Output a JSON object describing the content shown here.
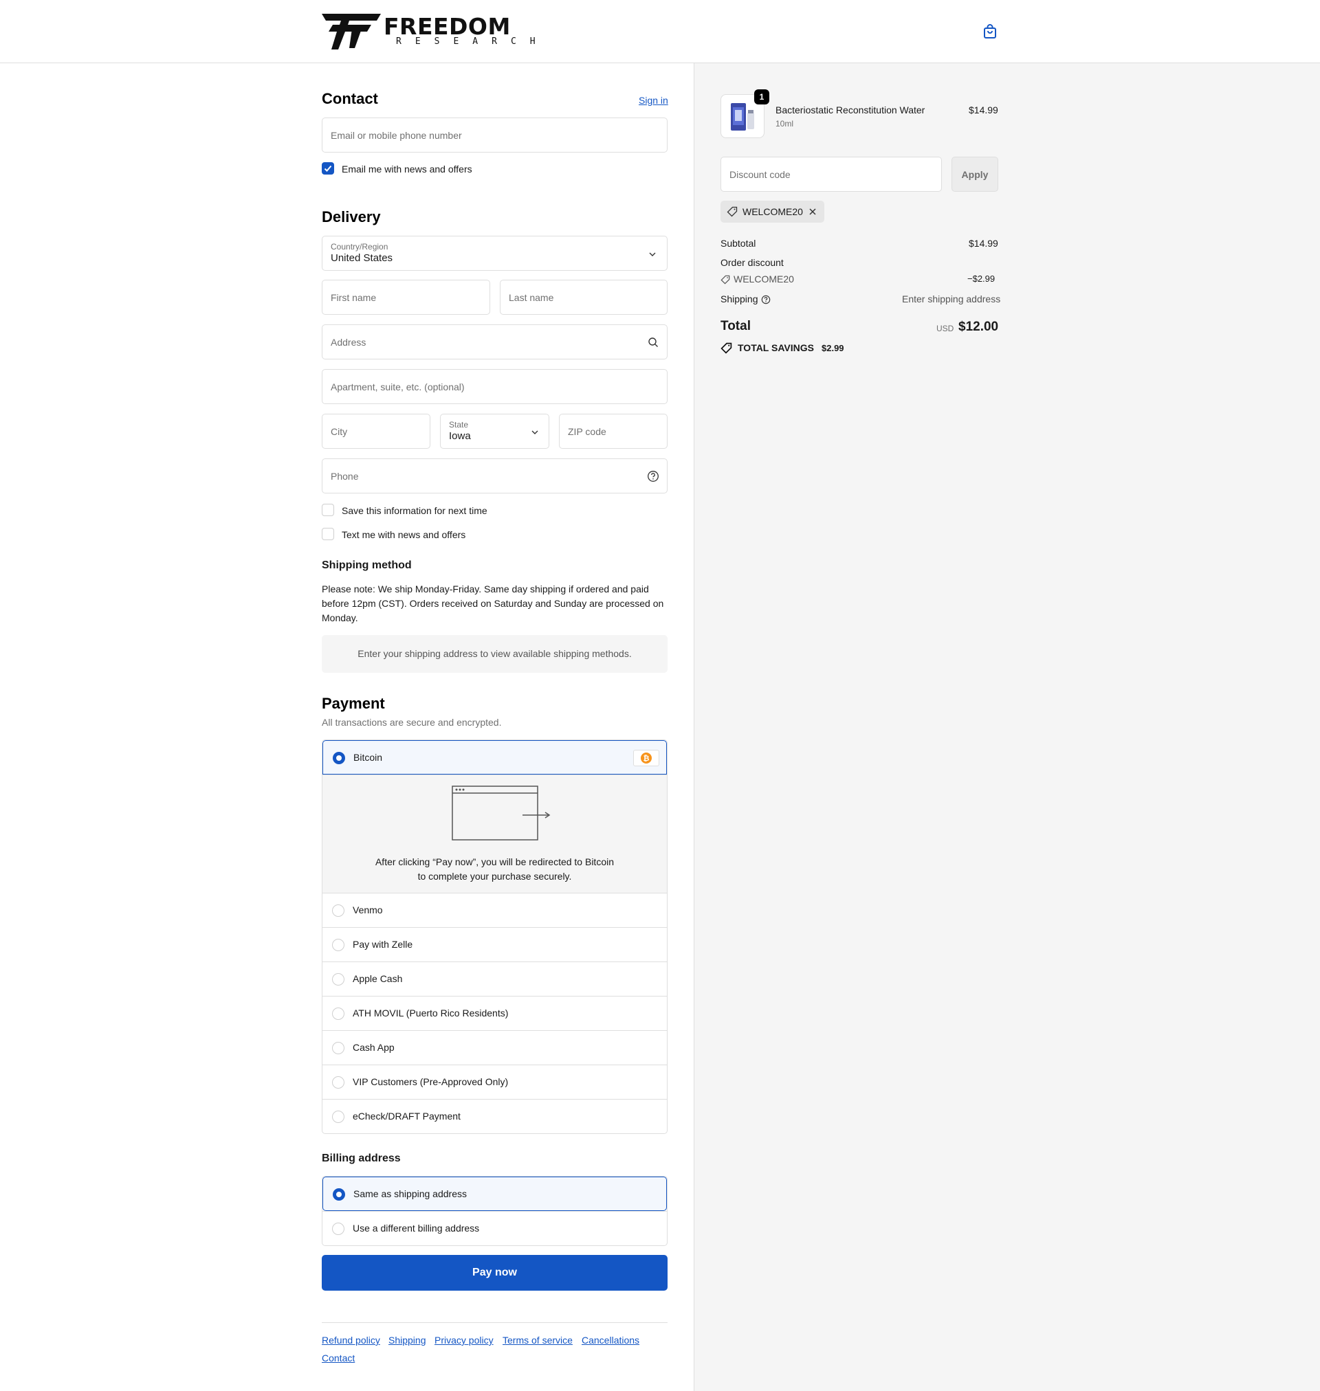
{
  "brand": {
    "name": "FREEDOM",
    "tagline": "RESEARCH"
  },
  "contact": {
    "title": "Contact",
    "sign_in": "Sign in",
    "email_placeholder": "Email or mobile phone number",
    "news_label": "Email me with news and offers",
    "news_checked": true
  },
  "delivery": {
    "title": "Delivery",
    "country_label": "Country/Region",
    "country_value": "United States",
    "first_name_placeholder": "First name",
    "last_name_placeholder": "Last name",
    "address_placeholder": "Address",
    "apartment_placeholder": "Apartment, suite, etc. (optional)",
    "city_placeholder": "City",
    "state_label": "State",
    "state_value": "Iowa",
    "zip_placeholder": "ZIP code",
    "phone_placeholder": "Phone",
    "save_info_label": "Save this information for next time",
    "text_me_label": "Text me with news and offers"
  },
  "shipping_method": {
    "title": "Shipping method",
    "note": "Please note: We ship Monday-Friday. Same day shipping if ordered and paid before 12pm (CST). Orders received on Saturday and Sunday are processed on Monday.",
    "placeholder_box": "Enter your shipping address to view available shipping methods."
  },
  "payment": {
    "title": "Payment",
    "subtitle": "All transactions are secure and encrypted.",
    "selected": "Bitcoin",
    "redirect_text_1": "After clicking “Pay now”, you will be redirected to Bitcoin",
    "redirect_text_2": "to complete your purchase securely.",
    "options": [
      "Venmo",
      "Pay with Zelle",
      "Apple Cash",
      "ATH MOVIL (Puerto Rico Residents)",
      "Cash App",
      "VIP Customers (Pre-Approved Only)",
      "eCheck/DRAFT Payment"
    ]
  },
  "billing": {
    "title": "Billing address",
    "same": "Same as shipping address",
    "different": "Use a different billing address"
  },
  "pay_button": "Pay now",
  "footer_links": [
    "Refund policy",
    "Shipping",
    "Privacy policy",
    "Terms of service",
    "Cancellations",
    "Contact"
  ],
  "summary": {
    "product_name": "Bacteriostatic Reconstitution Water",
    "product_variant": "10ml",
    "product_price": "$14.99",
    "quantity_badge": "1",
    "discount_placeholder": "Discount code",
    "apply_label": "Apply",
    "applied_code": "WELCOME20",
    "subtotal_label": "Subtotal",
    "subtotal_value": "$14.99",
    "order_discount_label": "Order discount",
    "discount_code": "WELCOME20",
    "discount_value": "−$2.99",
    "shipping_label": "Shipping",
    "shipping_value": "Enter shipping address",
    "total_label": "Total",
    "currency": "USD",
    "total_value": "$12.00",
    "savings_label": "TOTAL SAVINGS",
    "savings_value": "$2.99"
  },
  "colors": {
    "accent": "#1456c4",
    "bitcoin": "#f7931a"
  }
}
